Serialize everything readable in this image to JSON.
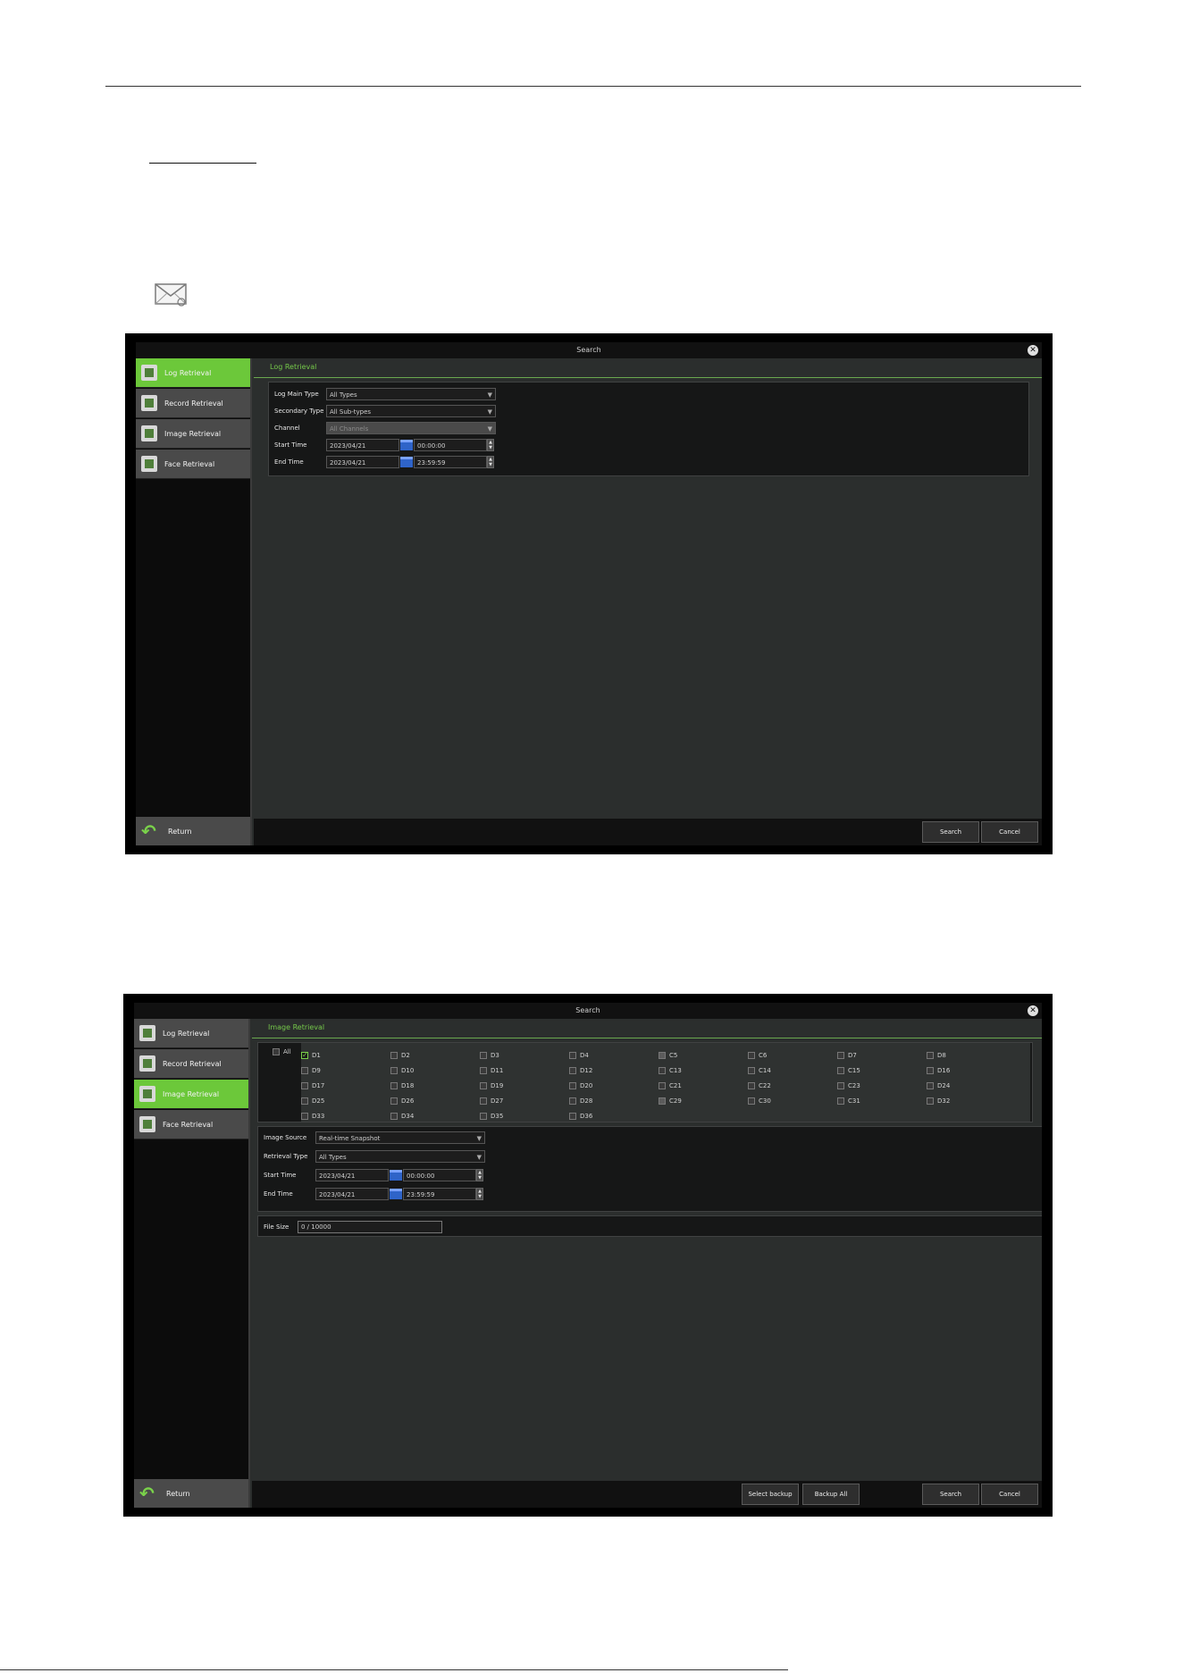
{
  "screen1": {
    "window_title": "Search",
    "close_label": "✕",
    "nav": [
      {
        "label": "Log Retrieval",
        "active": true
      },
      {
        "label": "Record Retrieval",
        "active": false
      },
      {
        "label": "Image Retrieval",
        "active": false
      },
      {
        "label": "Face Retrieval",
        "active": false
      }
    ],
    "return_label": "Return",
    "section_title": "Log Retrieval",
    "fields": {
      "main_type_label": "Log Main Type",
      "main_type_value": "All Types",
      "secondary_type_label": "Secondary Type",
      "secondary_type_value": "All Sub-types",
      "channel_label": "Channel",
      "channel_value": "All Channels",
      "start_time_label": "Start Time",
      "start_date": "2023/04/21",
      "start_clock": "00:00:00",
      "end_time_label": "End Time",
      "end_date": "2023/04/21",
      "end_clock": "23:59:59"
    },
    "buttons": {
      "search": "Search",
      "cancel": "Cancel"
    }
  },
  "screen2": {
    "window_title": "Search",
    "close_label": "✕",
    "nav": [
      {
        "label": "Log Retrieval",
        "active": false
      },
      {
        "label": "Record Retrieval",
        "active": false
      },
      {
        "label": "Image Retrieval",
        "active": true
      },
      {
        "label": "Face Retrieval",
        "active": false
      }
    ],
    "return_label": "Return",
    "section_title": "Image Retrieval",
    "all_label": "All",
    "channels": [
      {
        "label": "D1",
        "checked": true
      },
      {
        "label": "D2"
      },
      {
        "label": "D3"
      },
      {
        "label": "D4"
      },
      {
        "label": "C5",
        "analog": true
      },
      {
        "label": "C6"
      },
      {
        "label": "D7"
      },
      {
        "label": "D8"
      },
      {
        "label": "D9"
      },
      {
        "label": "D10"
      },
      {
        "label": "D11"
      },
      {
        "label": "D12"
      },
      {
        "label": "C13"
      },
      {
        "label": "C14"
      },
      {
        "label": "C15"
      },
      {
        "label": "D16"
      },
      {
        "label": "D17"
      },
      {
        "label": "D18"
      },
      {
        "label": "D19"
      },
      {
        "label": "D20"
      },
      {
        "label": "C21"
      },
      {
        "label": "C22"
      },
      {
        "label": "C23"
      },
      {
        "label": "D24"
      },
      {
        "label": "D25"
      },
      {
        "label": "D26"
      },
      {
        "label": "D27"
      },
      {
        "label": "D28"
      },
      {
        "label": "C29",
        "analog": true
      },
      {
        "label": "C30"
      },
      {
        "label": "C31"
      },
      {
        "label": "D32"
      },
      {
        "label": "D33"
      },
      {
        "label": "D34"
      },
      {
        "label": "D35"
      },
      {
        "label": "D36"
      }
    ],
    "fields": {
      "image_source_label": "Image Source",
      "image_source_value": "Real-time Snapshot",
      "retrieval_type_label": "Retrieval Type",
      "retrieval_type_value": "All Types",
      "start_time_label": "Start Time",
      "start_date": "2023/04/21",
      "start_clock": "00:00:00",
      "end_time_label": "End Time",
      "end_date": "2023/04/21",
      "end_clock": "23:59:59",
      "file_size_label": "File Size",
      "file_size_value": "0 / 10000"
    },
    "buttons": {
      "backup": "Select backup",
      "backup_all": "Backup All",
      "search": "Search",
      "cancel": "Cancel"
    }
  }
}
